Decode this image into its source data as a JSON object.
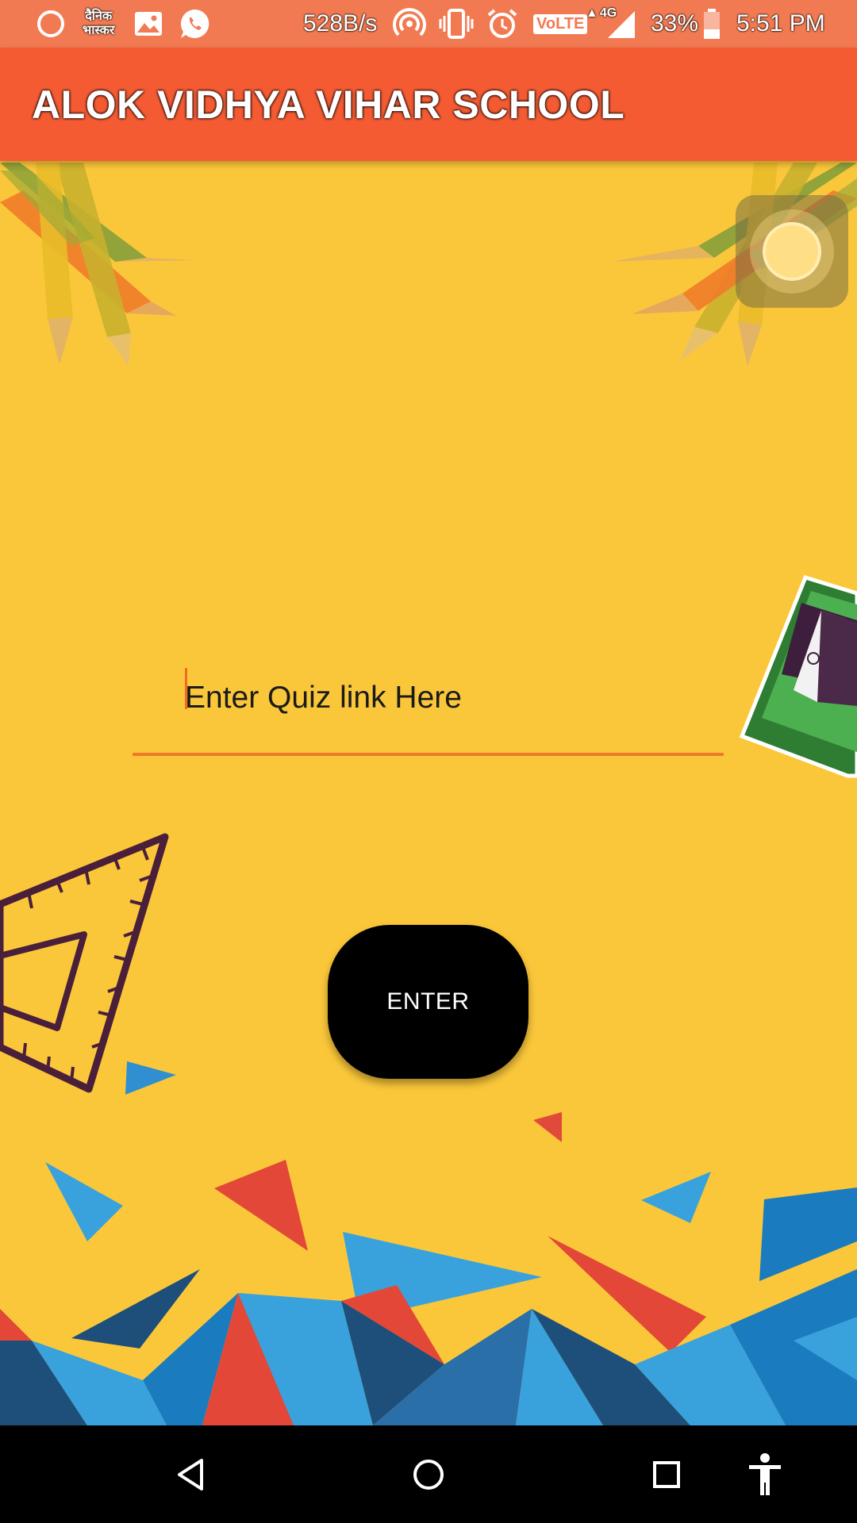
{
  "status_bar": {
    "network_speed": "528B/s",
    "volte_label": "VoLTE",
    "network_type": "4G",
    "battery_percent": "33%",
    "time": "5:51 PM",
    "notification_icons": [
      "circle-icon",
      "dainik-bhaskar-icon",
      "gallery-icon",
      "whatsapp-icon"
    ],
    "system_icons": [
      "hotspot-icon",
      "vibrate-icon",
      "alarm-icon",
      "volte-icon",
      "signal-icon",
      "battery-icon"
    ],
    "dainik_bhaskar_icon_text": [
      "दैनिक",
      "भास्कर"
    ]
  },
  "app_bar": {
    "title": "ALOK VIDHYA VIHAR SCHOOL",
    "background_color": "#f45b33"
  },
  "quiz_input": {
    "placeholder": "Enter Quiz link Here",
    "value": "",
    "accent_color": "#ef7a27"
  },
  "enter_button": {
    "label": "ENTER",
    "background_color": "#000000"
  },
  "navigation_bar": {
    "buttons": [
      "back-icon",
      "home-icon",
      "recents-icon",
      "accessibility-icon"
    ]
  },
  "theme": {
    "background_color": "#fbc73a"
  }
}
